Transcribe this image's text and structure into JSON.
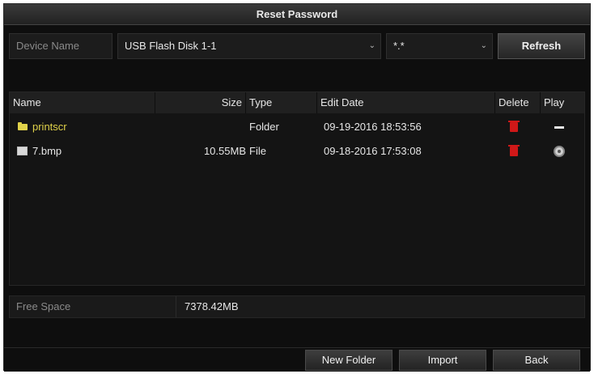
{
  "window": {
    "title": "Reset Password"
  },
  "device": {
    "label": "Device Name",
    "selected": "USB Flash Disk 1-1",
    "file_type": "*.*",
    "refresh_label": "Refresh"
  },
  "table": {
    "columns": {
      "name": "Name",
      "size": "Size",
      "type": "Type",
      "edit_date": "Edit Date",
      "delete": "Delete",
      "play": "Play"
    },
    "rows": [
      {
        "icon": "folder-icon",
        "name": "printscr",
        "size": "",
        "type": "Folder",
        "edit_date": "09-19-2016 18:53:56",
        "delete_icon": "trash-icon",
        "play_icon": "dash-icon"
      },
      {
        "icon": "file-icon",
        "name": "7.bmp",
        "size": "10.55MB",
        "type": "File",
        "edit_date": "09-18-2016 17:53:08",
        "delete_icon": "trash-icon",
        "play_icon": "play-icon"
      }
    ]
  },
  "storage": {
    "label": "Free Space",
    "value": "7378.42MB"
  },
  "actions": {
    "new_folder": "New Folder",
    "import": "Import",
    "back": "Back"
  },
  "colors": {
    "folder": "#e0d24a",
    "delete": "#d01818",
    "background": "#0e0e0e"
  }
}
